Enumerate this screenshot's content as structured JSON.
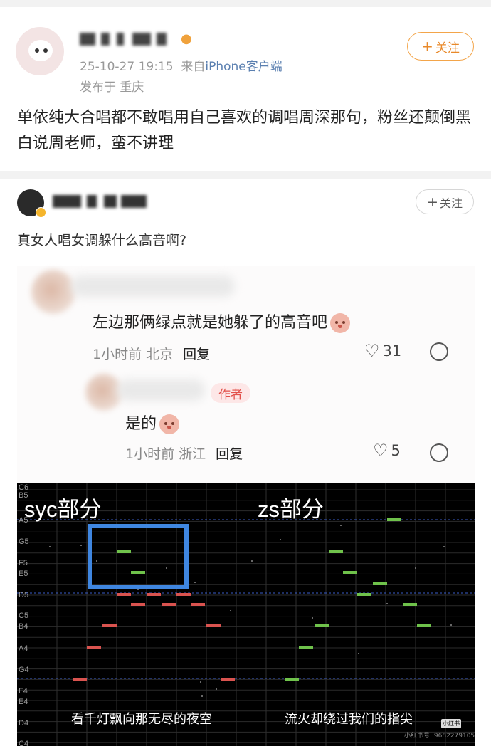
{
  "post": {
    "follow_label": "关注",
    "datetime": "25-10-27 19:15",
    "source_prefix": "来自",
    "source": "iPhone客户端",
    "location": "发布于 重庆",
    "text": "单依纯大合唱都不敢唱用自己喜欢的调唱周深那句，粉丝还颠倒黑白说周老师，蛮不讲理"
  },
  "repost": {
    "follow_label": "关注",
    "text": "真女人唱女调躲什么高音啊?"
  },
  "comments": [
    {
      "text": "左边那俩绿点就是她躲了的高音吧",
      "time": "1小时前",
      "location": "北京",
      "reply": "回复",
      "likes": "31"
    },
    {
      "tag": "作者",
      "text": "是的",
      "time": "1小时前",
      "location": "浙江",
      "reply": "回复",
      "likes": "5"
    }
  ],
  "chart_data": {
    "type": "pitch-roll",
    "left_title": "syc部分",
    "right_title": "zs部分",
    "left_lyric": "看千灯飘向那无尽的夜空",
    "right_lyric": "流火却绕过我们的指尖",
    "note_labels": [
      "C6",
      "B5",
      "A5",
      "G5",
      "F5",
      "E5",
      "D5",
      "C5",
      "B4",
      "A4",
      "G4",
      "F4",
      "E4",
      "D4",
      "C4"
    ],
    "watermark_small": "小红书",
    "watermark_id": "小红书号: 9682279105"
  }
}
